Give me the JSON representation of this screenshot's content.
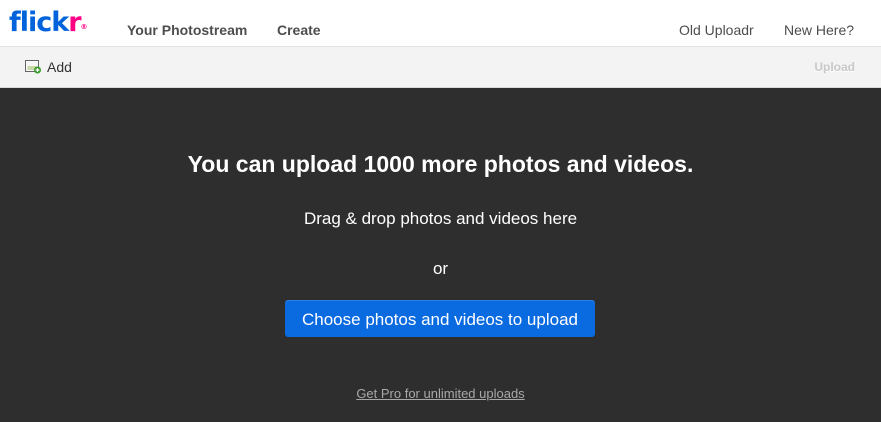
{
  "header": {
    "logo": {
      "part1": "flick",
      "part2": "r",
      "mark": "®"
    },
    "nav": [
      {
        "label": "Your Photostream"
      },
      {
        "label": "Create"
      }
    ],
    "right": [
      {
        "label": "Old Uploadr"
      },
      {
        "label": "New Here?"
      }
    ]
  },
  "toolbar": {
    "add_label": "Add",
    "add_icon": "add-photo-icon",
    "upload_label": "Upload"
  },
  "main": {
    "headline": "You can upload 1000 more photos and videos.",
    "drag_text": "Drag & drop photos and videos here",
    "or_text": "or",
    "choose_button": "Choose photos and videos to upload",
    "pro_link": "Get Pro for unlimited uploads"
  },
  "colors": {
    "brand_blue": "#0063dc",
    "brand_pink": "#ff0084",
    "button_blue": "#0a6ae0",
    "background_dark": "#2e2e2e"
  }
}
